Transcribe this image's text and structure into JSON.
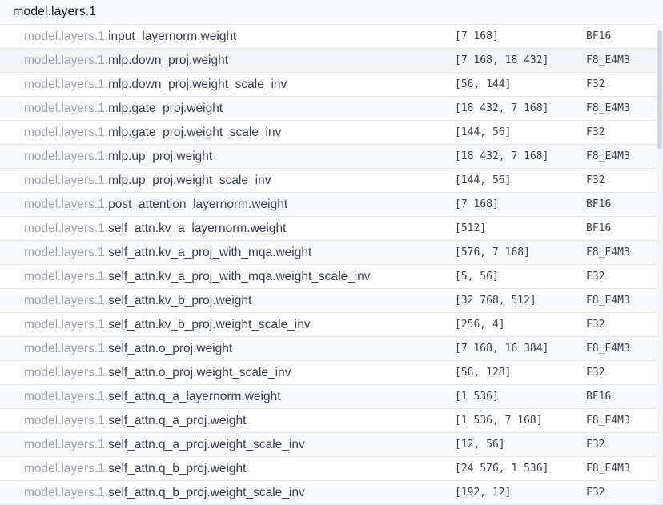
{
  "group": {
    "title": "model.layers.1"
  },
  "rows": [
    {
      "prefix": "model.layers.1.",
      "suffix": "input_layernorm.weight",
      "shape": "[7 168]",
      "dtype": "BF16"
    },
    {
      "prefix": "model.layers.1.",
      "suffix": "mlp.down_proj.weight",
      "shape": "[7 168, 18 432]",
      "dtype": "F8_E4M3"
    },
    {
      "prefix": "model.layers.1.",
      "suffix": "mlp.down_proj.weight_scale_inv",
      "shape": "[56, 144]",
      "dtype": "F32"
    },
    {
      "prefix": "model.layers.1.",
      "suffix": "mlp.gate_proj.weight",
      "shape": "[18 432, 7 168]",
      "dtype": "F8_E4M3"
    },
    {
      "prefix": "model.layers.1.",
      "suffix": "mlp.gate_proj.weight_scale_inv",
      "shape": "[144, 56]",
      "dtype": "F32"
    },
    {
      "prefix": "model.layers.1.",
      "suffix": "mlp.up_proj.weight",
      "shape": "[18 432, 7 168]",
      "dtype": "F8_E4M3"
    },
    {
      "prefix": "model.layers.1.",
      "suffix": "mlp.up_proj.weight_scale_inv",
      "shape": "[144, 56]",
      "dtype": "F32"
    },
    {
      "prefix": "model.layers.1.",
      "suffix": "post_attention_layernorm.weight",
      "shape": "[7 168]",
      "dtype": "BF16"
    },
    {
      "prefix": "model.layers.1.",
      "suffix": "self_attn.kv_a_layernorm.weight",
      "shape": "[512]",
      "dtype": "BF16"
    },
    {
      "prefix": "model.layers.1.",
      "suffix": "self_attn.kv_a_proj_with_mqa.weight",
      "shape": "[576, 7 168]",
      "dtype": "F8_E4M3"
    },
    {
      "prefix": "model.layers.1.",
      "suffix": "self_attn.kv_a_proj_with_mqa.weight_scale_inv",
      "shape": "[5, 56]",
      "dtype": "F32"
    },
    {
      "prefix": "model.layers.1.",
      "suffix": "self_attn.kv_b_proj.weight",
      "shape": "[32 768, 512]",
      "dtype": "F8_E4M3"
    },
    {
      "prefix": "model.layers.1.",
      "suffix": "self_attn.kv_b_proj.weight_scale_inv",
      "shape": "[256, 4]",
      "dtype": "F32"
    },
    {
      "prefix": "model.layers.1.",
      "suffix": "self_attn.o_proj.weight",
      "shape": "[7 168, 16 384]",
      "dtype": "F8_E4M3"
    },
    {
      "prefix": "model.layers.1.",
      "suffix": "self_attn.o_proj.weight_scale_inv",
      "shape": "[56, 128]",
      "dtype": "F32"
    },
    {
      "prefix": "model.layers.1.",
      "suffix": "self_attn.q_a_layernorm.weight",
      "shape": "[1 536]",
      "dtype": "BF16"
    },
    {
      "prefix": "model.layers.1.",
      "suffix": "self_attn.q_a_proj.weight",
      "shape": "[1 536, 7 168]",
      "dtype": "F8_E4M3"
    },
    {
      "prefix": "model.layers.1.",
      "suffix": "self_attn.q_a_proj.weight_scale_inv",
      "shape": "[12, 56]",
      "dtype": "F32"
    },
    {
      "prefix": "model.layers.1.",
      "suffix": "self_attn.q_b_proj.weight",
      "shape": "[24 576, 1 536]",
      "dtype": "F8_E4M3"
    },
    {
      "prefix": "model.layers.1.",
      "suffix": "self_attn.q_b_proj.weight_scale_inv",
      "shape": "[192, 12]",
      "dtype": "F32"
    }
  ]
}
